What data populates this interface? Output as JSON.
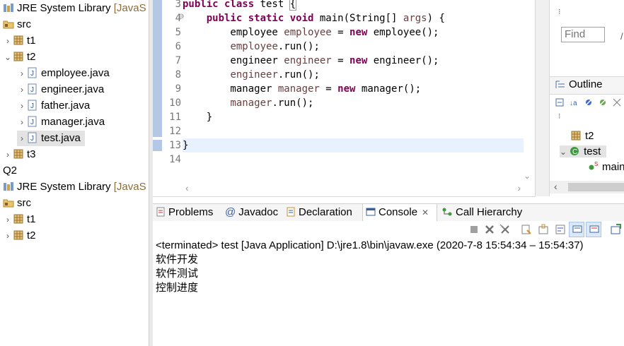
{
  "explorer": {
    "rows": [
      {
        "label": "JRE System Library",
        "suffix": "[JavaS"
      },
      {
        "label": "src"
      },
      {
        "label": "t1"
      },
      {
        "label": "t2"
      },
      {
        "label": "employee.java"
      },
      {
        "label": "engineer.java"
      },
      {
        "label": "father.java"
      },
      {
        "label": "manager.java"
      },
      {
        "label": "test.java"
      },
      {
        "label": "t3"
      },
      {
        "label": "Q2"
      },
      {
        "label": "JRE System Library",
        "suffix": "[JavaS"
      },
      {
        "label": "src"
      },
      {
        "label": "t1"
      },
      {
        "label": "t2"
      }
    ]
  },
  "editor": {
    "line_numbers": [
      "3",
      "4",
      "5",
      "6",
      "7",
      "8",
      "9",
      "10",
      "11",
      "12",
      "13",
      "14"
    ],
    "code": {
      "l3_kw": "public class ",
      "l3_rest": "test ",
      "l3_brace": "{",
      "l4_indent": "    ",
      "l4_kw": "public static void ",
      "l4_rest": "main(String[] ",
      "l4_var": "args",
      "l4_end": ") {",
      "l5_type": "        employee ",
      "l5_var": "employee",
      "l5_eq": " = ",
      "l5_new": "new ",
      "l5_end": "employee();",
      "l6_indent": "        ",
      "l6_var": "employee",
      "l6_end": ".run();",
      "l7_type": "        engineer ",
      "l7_var": "engineer",
      "l7_eq": " = ",
      "l7_new": "new ",
      "l7_end": "engineer();",
      "l8_indent": "        ",
      "l8_var": "engineer",
      "l8_end": ".run();",
      "l9_type": "        manager ",
      "l9_var": "manager",
      "l9_eq": " = ",
      "l9_new": "new ",
      "l9_end": "manager();",
      "l10_indent": "        ",
      "l10_var": "manager",
      "l10_end": ".run();",
      "l11": "    }",
      "l12": "",
      "l13": "}",
      "l14": ""
    }
  },
  "right_pane": {
    "find_placeholder": "Find",
    "outline_title": "Outline",
    "outline_items": [
      "t2",
      "test",
      "main"
    ]
  },
  "console": {
    "tabs": [
      "Problems",
      "Javadoc",
      "Declaration",
      "Console",
      "Call Hierarchy"
    ],
    "status": "<terminated> test [Java Application] D:\\jre1.8\\bin\\javaw.exe  (2020-7-8 15:54:34 – 15:54:37)",
    "output": [
      "软件开发",
      "软件测试",
      "控制进度"
    ]
  },
  "colors": {
    "keyword": "#7f0055",
    "variable": "#6a3e3e",
    "current_line": "#e8f2fe"
  }
}
